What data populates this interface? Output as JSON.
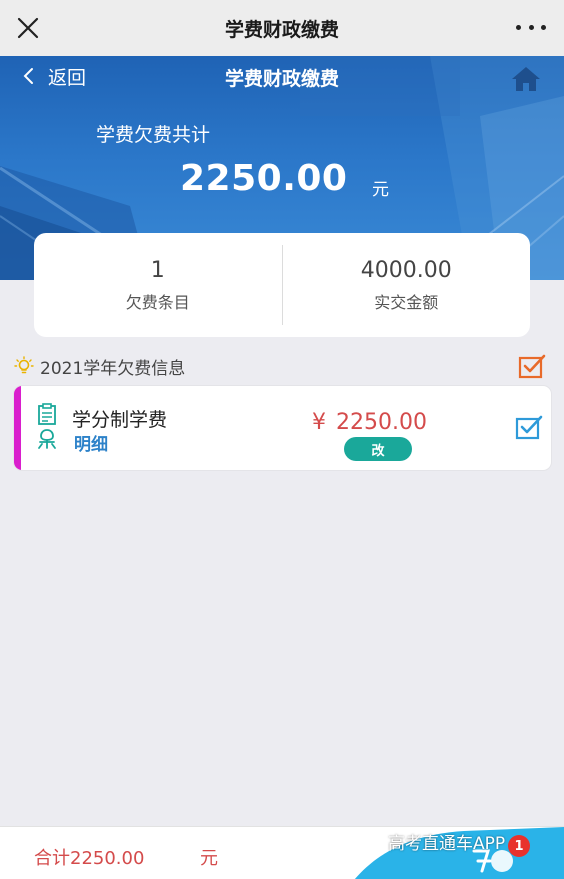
{
  "topbar": {
    "title": "学费财政缴费",
    "close_icon": "close-icon",
    "more_icon": "more-icon"
  },
  "hero": {
    "back_label": "返回",
    "title": "学费财政缴费",
    "home_icon": "home-icon",
    "owed_label": "学费欠费共计",
    "owed_amount": "2250.00",
    "owed_unit": "元"
  },
  "stats": {
    "owed_items": {
      "value": "1",
      "label": "欠费条目"
    },
    "paid_amount": {
      "value": "4000.00",
      "label": "实交金额"
    }
  },
  "section": {
    "title": "2021学年欠费信息",
    "icon": "bulb-icon",
    "select_all_checked": true
  },
  "fee_items": [
    {
      "name": "学分制学费",
      "detail_label": "明细",
      "currency": "¥",
      "amount": "2250.00",
      "edit_label": "改",
      "checked": true
    }
  ],
  "bottom": {
    "total_text": "合计2250.00",
    "total_unit": "元",
    "watermark": "高考直通车APP",
    "badge": "1"
  },
  "colors": {
    "hero_blue": "#2b77c9",
    "accent_red": "#d44b4b",
    "accent_magenta": "#d91ecd",
    "accent_teal": "#1aa89a",
    "check_orange": "#e86a2a",
    "check_blue": "#2e9ad9",
    "link_blue": "#2d82c9"
  }
}
